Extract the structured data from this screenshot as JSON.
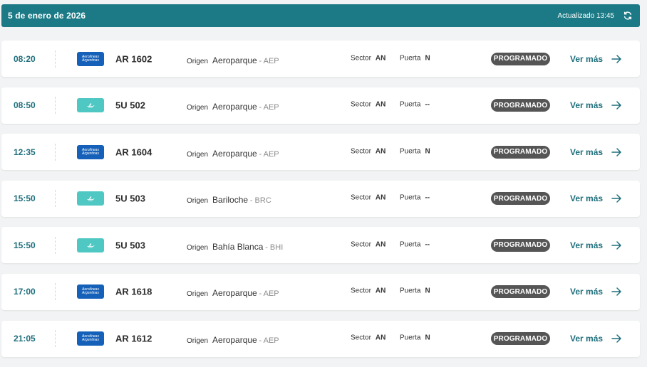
{
  "header": {
    "date": "5 de enero de 2026",
    "updated": "Actualizado 13:45",
    "bg_color": "#1b7a85"
  },
  "labels": {
    "origin": "Origen",
    "sector": "Sector",
    "gate": "Puerta",
    "more": "Ver más"
  },
  "airline_logos": {
    "AR": {
      "text": "Aerolíneas\nArgentinas",
      "color": "#1560b8",
      "icon": "aerolineas-argentinas-logo"
    },
    "5U": {
      "text": "",
      "color": "#4fc7c2",
      "icon": "flybondi-logo"
    }
  },
  "flights": [
    {
      "time": "08:20",
      "airline": "AR",
      "flight": "AR 1602",
      "city": "Aeroparque",
      "code": "- AEP",
      "sector": "AN",
      "gate": "N",
      "status": "PROGRAMADO"
    },
    {
      "time": "08:50",
      "airline": "5U",
      "flight": "5U 502",
      "city": "Aeroparque",
      "code": "- AEP",
      "sector": "AN",
      "gate": "--",
      "status": "PROGRAMADO"
    },
    {
      "time": "12:35",
      "airline": "AR",
      "flight": "AR 1604",
      "city": "Aeroparque",
      "code": "- AEP",
      "sector": "AN",
      "gate": "N",
      "status": "PROGRAMADO"
    },
    {
      "time": "15:50",
      "airline": "5U",
      "flight": "5U 503",
      "city": "Bariloche",
      "code": "- BRC",
      "sector": "AN",
      "gate": "--",
      "status": "PROGRAMADO"
    },
    {
      "time": "15:50",
      "airline": "5U",
      "flight": "5U 503",
      "city": "Bahía Blanca",
      "code": "- BHI",
      "sector": "AN",
      "gate": "--",
      "status": "PROGRAMADO"
    },
    {
      "time": "17:00",
      "airline": "AR",
      "flight": "AR 1618",
      "city": "Aeroparque",
      "code": "- AEP",
      "sector": "AN",
      "gate": "N",
      "status": "PROGRAMADO"
    },
    {
      "time": "21:05",
      "airline": "AR",
      "flight": "AR 1612",
      "city": "Aeroparque",
      "code": "- AEP",
      "sector": "AN",
      "gate": "N",
      "status": "PROGRAMADO"
    }
  ]
}
